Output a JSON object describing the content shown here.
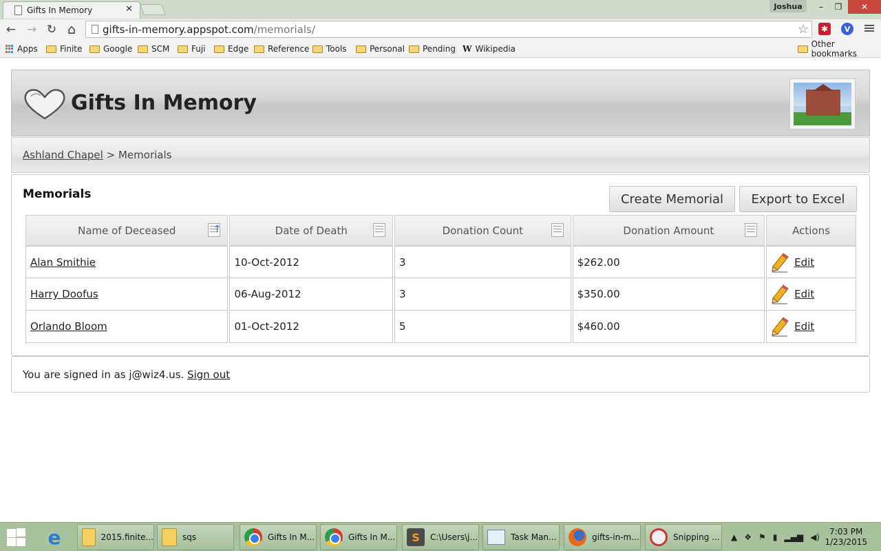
{
  "browser": {
    "tab_title": "Gifts In Memory",
    "tab_close": "✕",
    "user": "Joshua",
    "window_controls": {
      "minimize": "–",
      "maximize": "❐",
      "close": "✕"
    },
    "nav": {
      "back": "←",
      "forward": "→",
      "reload": "↻",
      "home": "⌂"
    },
    "url_host": "gifts-in-memory.appspot.com",
    "url_path": "/memorials/",
    "bookmarks": [
      "Apps",
      "Finite",
      "Google",
      "SCM",
      "Fuji",
      "Edge",
      "Reference",
      "Tools",
      "Personal",
      "Pending",
      "Wikipedia"
    ],
    "other_bookmarks": "Other bookmarks"
  },
  "site": {
    "title": "Gifts In Memory"
  },
  "breadcrumb": {
    "parent": "Ashland Chapel",
    "separator": ">",
    "current": "Memorials"
  },
  "memorials": {
    "heading": "Memorials",
    "create_button": "Create Memorial",
    "export_button": "Export to Excel",
    "columns": [
      "Name of Deceased",
      "Date of Death",
      "Donation Count",
      "Donation Amount",
      "Actions"
    ],
    "rows": [
      {
        "name": "Alan Smithie",
        "date": "10-Oct-2012",
        "count": "3",
        "amount": "$262.00",
        "action": "Edit"
      },
      {
        "name": "Harry Doofus",
        "date": "06-Aug-2012",
        "count": "3",
        "amount": "$350.00",
        "action": "Edit"
      },
      {
        "name": "Orlando Bloom",
        "date": "01-Oct-2012",
        "count": "5",
        "amount": "$460.00",
        "action": "Edit"
      }
    ]
  },
  "footer": {
    "signed_in_text": "You are signed in as j@wiz4.us.",
    "sign_out": "Sign out"
  },
  "taskbar": {
    "items": [
      "2015.finite...",
      "sqs",
      "Gifts In M...",
      "Gifts In M...",
      "C:\\Users\\j...",
      "Task Man...",
      "gifts-in-m...",
      "Snipping ..."
    ],
    "time": "7:03 PM",
    "date": "1/23/2015"
  },
  "colors": {
    "header_gradient": "#d9d9d9",
    "taskbar": "#a9c29e",
    "titlebar": "#cfdcc9"
  }
}
